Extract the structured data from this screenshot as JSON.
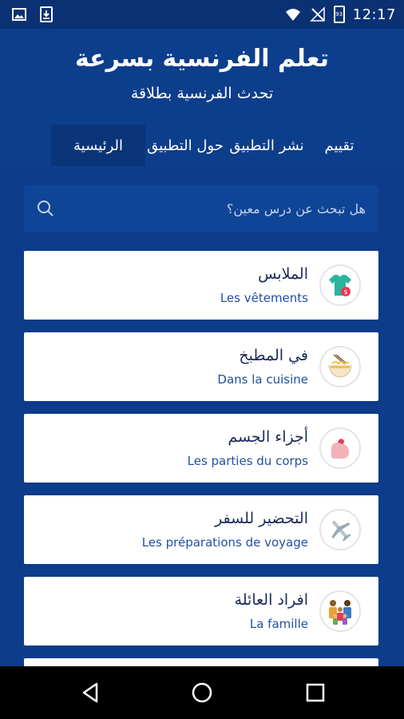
{
  "status_bar": {
    "time": "12:17",
    "left_icons": [
      "image-icon",
      "download-icon"
    ],
    "right_icons": [
      "wifi-icon",
      "no-signal-icon",
      "battery-icon"
    ],
    "battery_level": "93"
  },
  "header": {
    "title": "تعلم الفرنسية بسرعة",
    "subtitle": "تحدث الفرنسية بطلاقة"
  },
  "tabs": [
    {
      "label": "الرئيسية",
      "active": true
    },
    {
      "label": "حول التطبيق",
      "active": false
    },
    {
      "label": "نشر التطبيق",
      "active": false
    },
    {
      "label": "تقييم",
      "active": false
    }
  ],
  "search": {
    "placeholder": "هل تبحث عن درس معين؟"
  },
  "lessons": [
    {
      "arabic": "الملابس",
      "french": "Les vêtements",
      "icon": "clothes-icon"
    },
    {
      "arabic": "في المطبخ",
      "french": "Dans la cuisine",
      "icon": "noodle-bowl-icon"
    },
    {
      "arabic": "أجزاء الجسم",
      "french": "Les parties du corps",
      "icon": "arm-icon"
    },
    {
      "arabic": "التحضير للسفر",
      "french": "Les préparations de voyage",
      "icon": "airplane-icon"
    },
    {
      "arabic": "افراد العائلة",
      "french": "La famille",
      "icon": "family-icon"
    }
  ],
  "colors": {
    "primary": "#0c3c8a",
    "status_bar": "#0a3173",
    "active_tab": "#0b3579",
    "card_text": "#1a2a5a",
    "card_subtext": "#2050a4"
  }
}
